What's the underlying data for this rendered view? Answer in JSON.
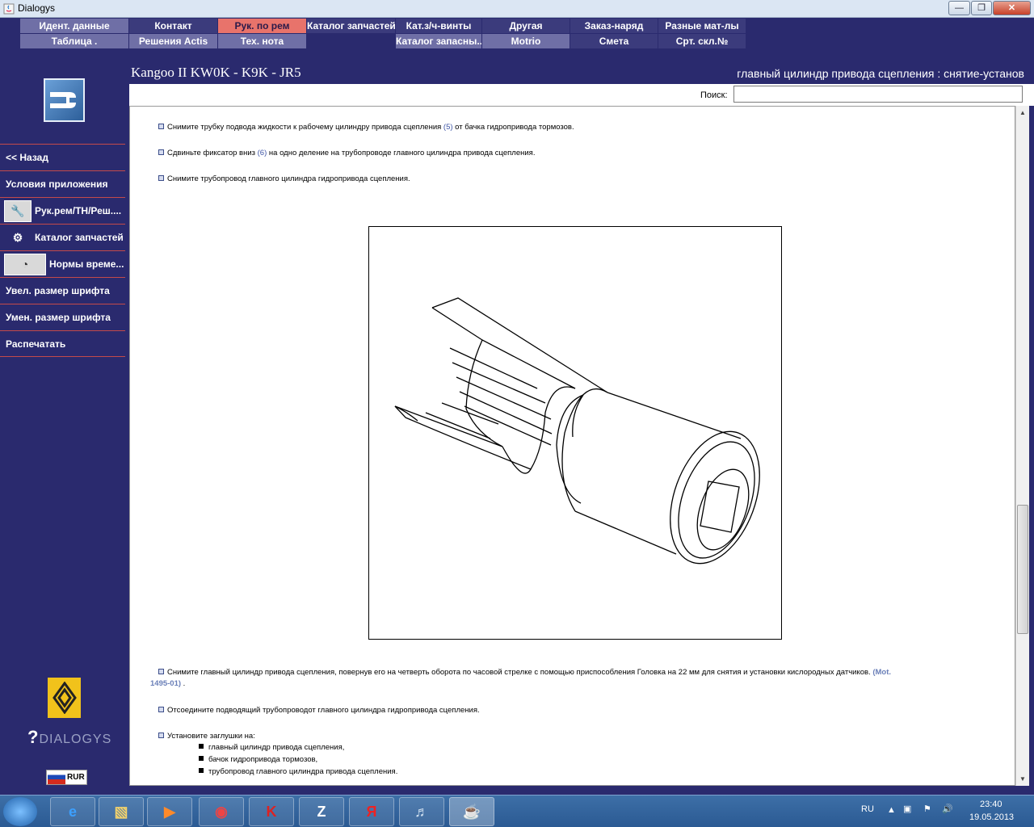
{
  "window": {
    "title": "Dialogys"
  },
  "menu": {
    "row1": [
      "Идент. данные",
      "Контакт",
      "Рук. по рем",
      "Каталог запчастей",
      "Кат.з/ч-винты",
      "Другая",
      "Заказ-наряд",
      "Разные мат-лы"
    ],
    "row2": [
      "Таблица .",
      "Решения Actis",
      "Тех. нота",
      "",
      "Каталог запасны...",
      "Motrio",
      "Смета",
      "Срт. скл.№"
    ]
  },
  "sidebar": {
    "items": [
      {
        "label": "<< Назад",
        "icon": ""
      },
      {
        "label": "Условия приложения",
        "icon": ""
      },
      {
        "label": "Рук.рем/ТН/Реш....",
        "icon": "wrench-icon"
      },
      {
        "label": "Каталог запчастей",
        "icon": "parts-icon"
      },
      {
        "label": "Нормы време...",
        "icon": "gauge-icon"
      },
      {
        "label": "Увел. размер шрифта",
        "icon": ""
      },
      {
        "label": "Умен. размер шрифта",
        "icon": ""
      },
      {
        "label": "Распечатать",
        "icon": ""
      }
    ],
    "brand": "DIALOGYS",
    "currency": "RUR"
  },
  "header": {
    "vehicle": "Kangoo II KW0K - K9K - JR5",
    "operation": "главный цилиндр привода сцепления : снятие-установ"
  },
  "search": {
    "label": "Поиск:",
    "value": ""
  },
  "doc": {
    "step1": {
      "before": "Снимите трубку подвода жидкости к рабочему цилиндру привода сцепления ",
      "ref": "(5)",
      "after": " от бачка гидропривода тормозов."
    },
    "step2": {
      "before": "Сдвиньте фиксатор вниз ",
      "ref": "(6)",
      "after": " на одно деление на трубопроводе главного цилиндра привода сцепления."
    },
    "step3": "Снимите трубопровод главного цилиндра гидропривода сцепления.",
    "step4": {
      "before": "Снимите главный цилиндр привода сцепления, повернув его на четверть оборота по часовой стрелке с помощью приспособления Головка на 22 мм для снятия и установки кислородных датчиков. ",
      "ref1": "(Mot.",
      "ref2": "1495-01)",
      "after": " ."
    },
    "step5": "Отсоедините подводящий трубопроводот главного цилиндра гидропривода сцепления.",
    "step6": "Установите заглушки на:",
    "subitems": [
      "главный цилиндр привода сцепления,",
      "бачок гидропривода тормозов,",
      "трубопровод главного цилиндра привода сцепления."
    ]
  },
  "taskbar": {
    "lang": "RU",
    "time": "23:40",
    "date": "19.05.2013"
  }
}
